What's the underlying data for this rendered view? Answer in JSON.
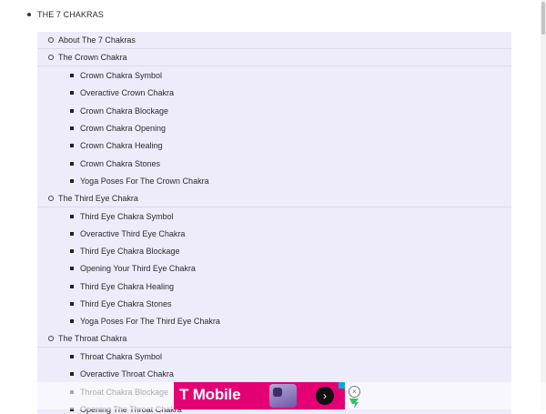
{
  "menu": {
    "top_label": "THE 7 CHAKRAS",
    "items": [
      {
        "level": 2,
        "label": "About The 7 Chakras"
      },
      {
        "level": 2,
        "label": "The Crown Chakra"
      },
      {
        "level": 3,
        "label": "Crown Chakra Symbol"
      },
      {
        "level": 3,
        "label": "Overactive Crown Chakra"
      },
      {
        "level": 3,
        "label": "Crown Chakra Blockage"
      },
      {
        "level": 3,
        "label": "Crown Chakra Opening"
      },
      {
        "level": 3,
        "label": "Crown Chakra Healing"
      },
      {
        "level": 3,
        "label": "Crown Chakra Stones"
      },
      {
        "level": 3,
        "label": "Yoga Poses For The Crown Chakra"
      },
      {
        "level": 2,
        "label": "The Third Eye Chakra"
      },
      {
        "level": 3,
        "label": "Third Eye Chakra Symbol"
      },
      {
        "level": 3,
        "label": "Overactive Third Eye Chakra"
      },
      {
        "level": 3,
        "label": "Third Eye Chakra Blockage"
      },
      {
        "level": 3,
        "label": "Opening Your Third Eye Chakra"
      },
      {
        "level": 3,
        "label": "Third Eye Chakra Healing"
      },
      {
        "level": 3,
        "label": "Third Eye Chakra Stones"
      },
      {
        "level": 3,
        "label": "Yoga Poses For The Third Eye Chakra"
      },
      {
        "level": 2,
        "label": "The Throat Chakra"
      },
      {
        "level": 3,
        "label": "Throat Chakra Symbol"
      },
      {
        "level": 3,
        "label": "Overactive Throat Chakra"
      },
      {
        "level": 3,
        "label": "Throat Chakra Blockage"
      },
      {
        "level": 3,
        "label": "Opening The Throat Chakra"
      }
    ]
  },
  "ad": {
    "brand": "T Mobile",
    "brand_color": "#e20074",
    "next_icon": "chevron-right-icon",
    "close_icon": "close-icon"
  },
  "colors": {
    "submenu_bg": "#eeecfb"
  }
}
